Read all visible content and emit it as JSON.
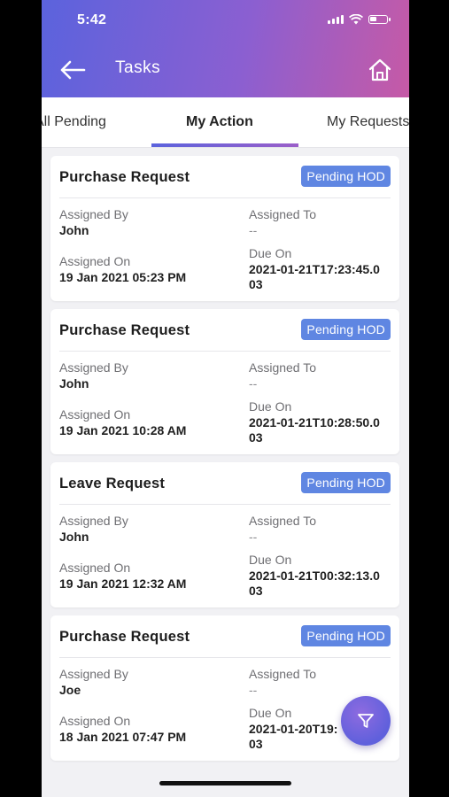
{
  "status": {
    "time": "5:42"
  },
  "header": {
    "title": "Tasks"
  },
  "tabs": [
    {
      "label": "All Pending"
    },
    {
      "label": "My Action"
    },
    {
      "label": "My Requests"
    }
  ],
  "fields": {
    "assigned_by": "Assigned By",
    "assigned_to": "Assigned To",
    "assigned_on": "Assigned On",
    "due_on": "Due On"
  },
  "cards": [
    {
      "title": "Purchase Request",
      "status": "Pending HOD",
      "assigned_by": "John",
      "assigned_to": "--",
      "assigned_on": "19 Jan 2021 05:23 PM",
      "due_on_1": "2021-01-21T17:23:45.0",
      "due_on_2": "03"
    },
    {
      "title": "Purchase Request",
      "status": "Pending HOD",
      "assigned_by": "John",
      "assigned_to": "--",
      "assigned_on": "19 Jan 2021 10:28 AM",
      "due_on_1": "2021-01-21T10:28:50.0",
      "due_on_2": "03"
    },
    {
      "title": "Leave Request",
      "status": "Pending HOD",
      "assigned_by": "John",
      "assigned_to": "--",
      "assigned_on": "19 Jan 2021 12:32 AM",
      "due_on_1": "2021-01-21T00:32:13.0",
      "due_on_2": "03"
    },
    {
      "title": "Purchase Request",
      "status": "Pending HOD",
      "assigned_by": "Joe",
      "assigned_to": "--",
      "assigned_on": "18 Jan 2021 07:47 PM",
      "due_on_1": "2021-01-20T19:",
      "due_on_2": "03"
    }
  ]
}
